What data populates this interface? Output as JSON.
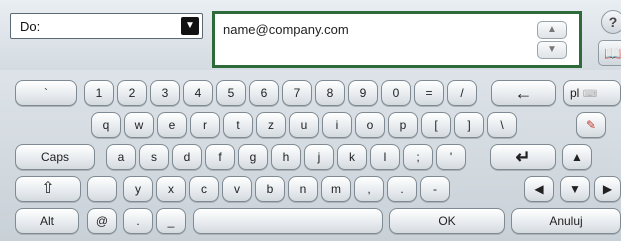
{
  "header": {
    "field_label": "Do:",
    "email_value": "name@company.com"
  },
  "icons": {
    "dropdown": "dropdown-arrow-icon",
    "help": "help-icon",
    "address_book": "address-book-icon",
    "scroll_up": "chevron-up-icon",
    "scroll_down": "chevron-down-icon"
  },
  "keyboard": {
    "row1": [
      "`",
      "1",
      "2",
      "3",
      "4",
      "5",
      "6",
      "7",
      "8",
      "9",
      "0",
      "=",
      "/"
    ],
    "backspace": "←",
    "lang": "pl",
    "row2": [
      "q",
      "w",
      "e",
      "r",
      "t",
      "z",
      "u",
      "i",
      "o",
      "p",
      "[",
      "]",
      "\\"
    ],
    "caps": "Caps",
    "row3": [
      "a",
      "s",
      "d",
      "f",
      "g",
      "h",
      "j",
      "k",
      "l",
      ";",
      "'"
    ],
    "row4": [
      "y",
      "x",
      "c",
      "v",
      "b",
      "n",
      "m",
      ",",
      ".",
      "-"
    ],
    "alt": "Alt",
    "at": "@",
    "dot": ".",
    "underscore": "_",
    "ok": "OK",
    "cancel": "Anuluj"
  }
}
